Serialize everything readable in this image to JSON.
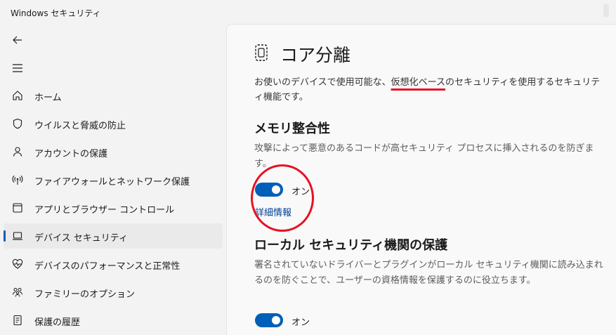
{
  "window": {
    "title": "Windows セキュリティ"
  },
  "sidebar": {
    "items": [
      {
        "label": "ホーム",
        "icon": "home-icon"
      },
      {
        "label": "ウイルスと脅威の防止",
        "icon": "shield-icon"
      },
      {
        "label": "アカウントの保護",
        "icon": "person-icon"
      },
      {
        "label": "ファイアウォールとネットワーク保護",
        "icon": "antenna-icon"
      },
      {
        "label": "アプリとブラウザー コントロール",
        "icon": "app-window-icon"
      },
      {
        "label": "デバイス セキュリティ",
        "icon": "laptop-icon",
        "selected": true
      },
      {
        "label": "デバイスのパフォーマンスと正常性",
        "icon": "heart-pulse-icon"
      },
      {
        "label": "ファミリーのオプション",
        "icon": "family-icon"
      },
      {
        "label": "保護の履歴",
        "icon": "history-icon"
      }
    ]
  },
  "main": {
    "title": "コア分離",
    "description_before": "お使いのデバイスで使用可能な、",
    "description_highlight": "仮想化ベース",
    "description_after": "のセキュリティを使用するセキュリティ機能です。",
    "memory_integrity": {
      "title": "メモリ整合性",
      "description": "攻撃によって悪意のあるコードが高セキュリティ プロセスに挿入されるのを防ぎます。",
      "toggle_label": "オン",
      "toggle_on": true,
      "link": "詳細情報"
    },
    "lsa_protection": {
      "title": "ローカル セキュリティ機関の保護",
      "description": "署名されていないドライバーとプラグインがローカル セキュリティ機関に読み込まれるのを防ぐことで、ユーザーの資格情報を保護するのに役立ちます。",
      "toggle_label": "オン",
      "toggle_on": true
    }
  },
  "colors": {
    "accent": "#005fb8",
    "link": "#003e92",
    "annotation_red": "#e81123"
  }
}
